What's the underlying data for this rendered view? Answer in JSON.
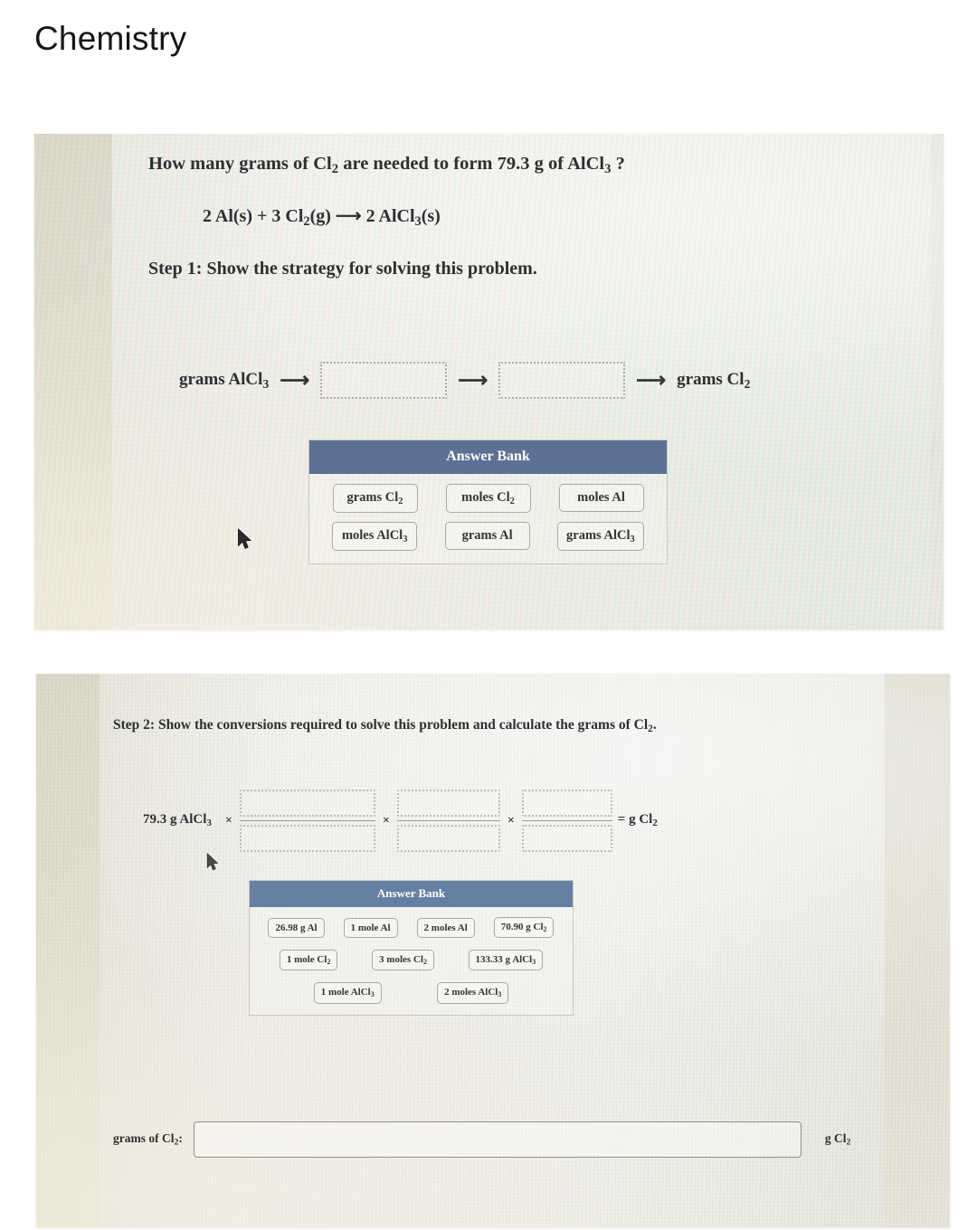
{
  "page": {
    "title": "Chemistry"
  },
  "colors": {
    "bank_header_1": "#5c7193",
    "bank_header_2": "#6680a3",
    "panel_paper": "#f2f1ec",
    "panel_margin": "#e2e0d0",
    "text": "#2e2f33"
  },
  "step1": {
    "question": "How many grams of Cl₂ are needed to form 79.3 g of AlCl₃ ?",
    "equation": "2 Al(s) + 3 Cl₂ (g) ⟶ 2 AlCl₃ (s)",
    "instruction": "Step 1: Show the strategy for solving this problem.",
    "flow": {
      "start_label": "grams AlCl₃",
      "end_label": "grams Cl₂",
      "arrow_glyph": "⟶",
      "slots": [
        "",
        ""
      ]
    },
    "answer_bank": {
      "header": "Answer Bank",
      "rows": [
        [
          "grams Cl₂",
          "moles Cl₂",
          "moles Al"
        ],
        [
          "moles AlCl₃",
          "grams Al",
          "grams AlCl₃"
        ]
      ]
    }
  },
  "step2": {
    "instruction": "Step 2: Show the conversions required to solve this problem and calculate the grams of Cl₂.",
    "conversion": {
      "start": "79.3 g AlCl₃",
      "multiply_glyph": "×",
      "equals_label": "= g Cl₂",
      "fractions": [
        {
          "numerator": "",
          "denominator": ""
        },
        {
          "numerator": "",
          "denominator": ""
        },
        {
          "numerator": "",
          "denominator": ""
        }
      ]
    },
    "answer_bank": {
      "header": "Answer Bank",
      "rows": [
        [
          "26.98 g Al",
          "1 mole Al",
          "2 moles Al",
          "70.90 g Cl₂"
        ],
        [
          "1 mole Cl₂",
          "3 moles Cl₂",
          "133.33 g AlCl₃"
        ],
        [
          "1 mole AlCl₃",
          "2 moles AlCl₃"
        ]
      ]
    },
    "final_answer": {
      "label": "grams of Cl₂:",
      "value": "",
      "placeholder": "",
      "unit": "g Cl₂"
    }
  }
}
